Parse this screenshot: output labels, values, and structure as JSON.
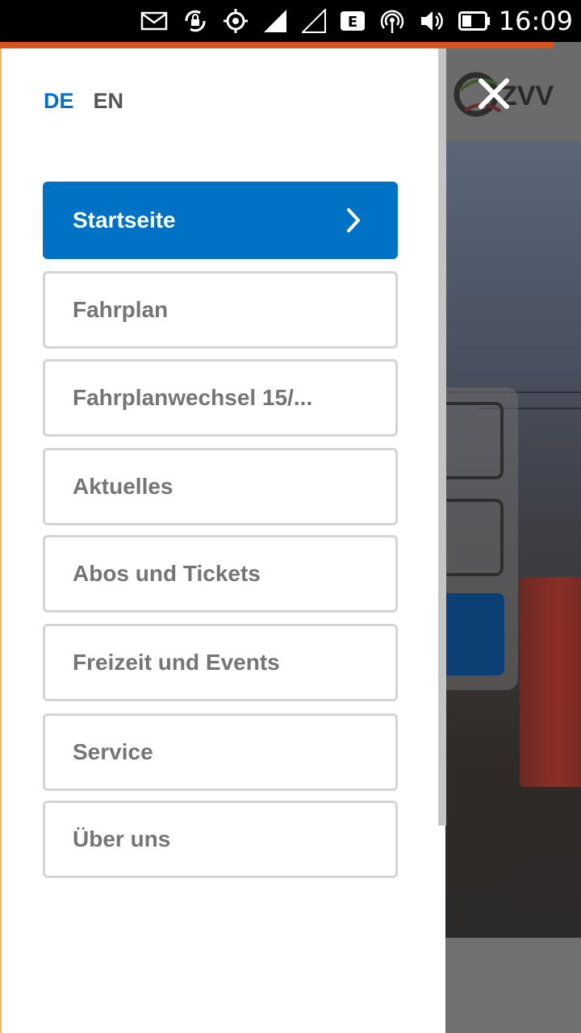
{
  "status_bar": {
    "time": "16:09",
    "icons": [
      "mail-icon",
      "screen-rotation-lock-icon",
      "location-icon",
      "signal-icon",
      "signal-empty-icon",
      "network-e-icon",
      "hotspot-icon",
      "volume-icon",
      "battery-icon"
    ],
    "network_label": "E"
  },
  "colors": {
    "accent": "#d9531e",
    "primary": "#0072c6",
    "menu_text": "#757575",
    "menu_border": "#d4d4d4"
  },
  "drawer": {
    "languages": [
      {
        "code": "DE",
        "active": true
      },
      {
        "code": "EN",
        "active": false
      }
    ],
    "menu": [
      {
        "label": "Startseite",
        "active": true
      },
      {
        "label": "Fahrplan",
        "active": false
      },
      {
        "label": "Fahrplanwechsel 15/...",
        "active": false
      },
      {
        "label": "Aktuelles",
        "active": false
      },
      {
        "label": "Abos und Tickets",
        "active": false
      },
      {
        "label": "Freizeit und Events",
        "active": false
      },
      {
        "label": "Service",
        "active": false
      },
      {
        "label": "Über uns",
        "active": false
      }
    ]
  },
  "background_page": {
    "logo_text": "ZVV"
  }
}
